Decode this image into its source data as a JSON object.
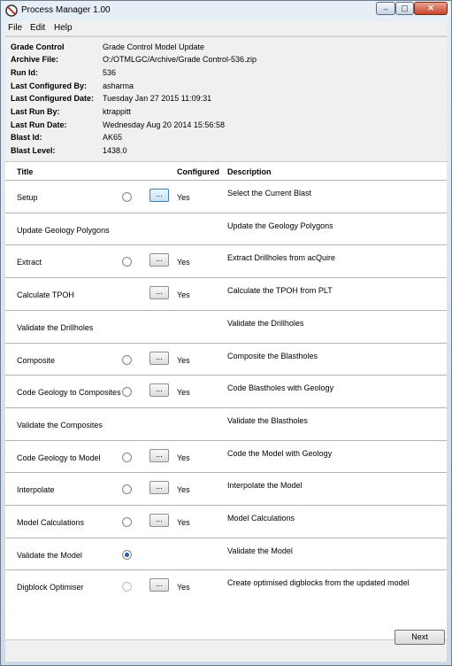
{
  "window": {
    "title": "Process Manager 1.00"
  },
  "window_controls": {
    "minimize": "‒",
    "maximize": "▢",
    "close": "✕"
  },
  "menu": [
    "File",
    "Edit",
    "Help"
  ],
  "info": [
    {
      "label": "Grade Control",
      "value": "Grade Control Model Update"
    },
    {
      "label": "Archive File:",
      "value": "O:/OTMLGC/Archive/Grade Control-536.zip"
    },
    {
      "label": "Run Id:",
      "value": "536"
    },
    {
      "label": "Last Configured By:",
      "value": "asharma"
    },
    {
      "label": "Last Configured Date:",
      "value": "Tuesday Jan 27 2015 11:09:31"
    },
    {
      "label": "Last Run By:",
      "value": "ktrappitt"
    },
    {
      "label": "Last Run Date:",
      "value": "Wednesday Aug 20 2014 15:56:58"
    },
    {
      "label": "Blast Id:",
      "value": "AK65"
    },
    {
      "label": "Blast Level:",
      "value": "1438.0"
    }
  ],
  "table": {
    "headers": {
      "title": "Title",
      "configured": "Configured",
      "description": "Description"
    },
    "rows": [
      {
        "title": "Setup",
        "radio": "unchecked",
        "button": "...",
        "button_focused": true,
        "configured": "Yes",
        "description": "Select the Current Blast"
      },
      {
        "title": "Update Geology Polygons",
        "radio": "none",
        "button": "",
        "configured": "",
        "description": "Update the Geology Polygons"
      },
      {
        "title": "Extract",
        "radio": "unchecked",
        "button": "...",
        "configured": "Yes",
        "description": "Extract Drillholes from acQuire"
      },
      {
        "title": "Calculate TPOH",
        "radio": "none",
        "button": "...",
        "configured": "Yes",
        "description": "Calculate the TPOH from PLT"
      },
      {
        "title": "Validate the Drillholes",
        "radio": "none",
        "button": "",
        "configured": "",
        "description": "Validate the Drillholes"
      },
      {
        "title": "Composite",
        "radio": "unchecked",
        "button": "...",
        "configured": "Yes",
        "description": "Composite the Blastholes"
      },
      {
        "title": "Code Geology to Composites",
        "radio": "unchecked",
        "button": "...",
        "configured": "Yes",
        "description": "Code Blastholes with Geology"
      },
      {
        "title": "Validate the Composites",
        "radio": "none",
        "button": "",
        "configured": "",
        "description": "Validate the Blastholes"
      },
      {
        "title": "Code Geology to Model",
        "radio": "unchecked",
        "button": "...",
        "configured": "Yes",
        "description": "Code the Model with Geology"
      },
      {
        "title": "Interpolate",
        "radio": "unchecked",
        "button": "...",
        "configured": "Yes",
        "description": "Interpolate the Model"
      },
      {
        "title": "Model Calculations",
        "radio": "unchecked",
        "button": "...",
        "configured": "Yes",
        "description": "Model Calculations"
      },
      {
        "title": "Validate the Model",
        "radio": "checked",
        "button": "",
        "configured": "",
        "description": "Validate the Model"
      },
      {
        "title": "Digblock Optimiser",
        "radio": "disabled",
        "button": "...",
        "configured": "Yes",
        "description": "Create optimised digblocks from the updated model"
      }
    ]
  },
  "footer": {
    "next_label": "Next"
  }
}
